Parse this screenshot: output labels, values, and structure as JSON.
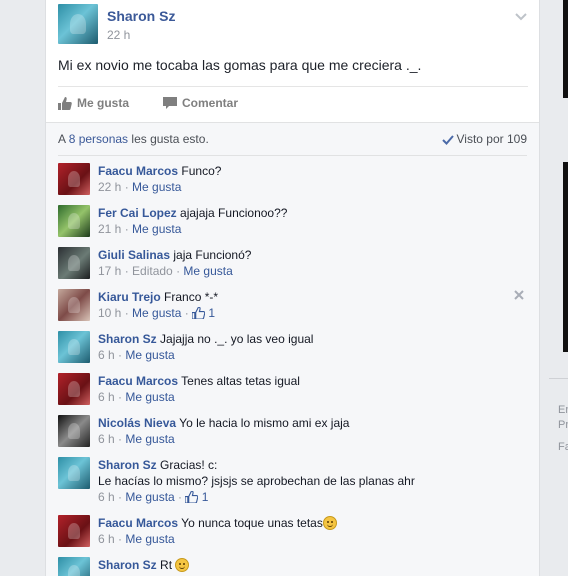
{
  "post": {
    "author": "Sharon Sz",
    "time": "22 h",
    "text": "Mi ex novio me tocaba las gomas para que me creciera ._.",
    "like_label": "Me gusta",
    "comment_label": "Comentar"
  },
  "likes": {
    "prefix": "A ",
    "people": "8 personas",
    "suffix": " les gusta esto.",
    "seen": "Visto por 109"
  },
  "comments": [
    {
      "name": "Faacu Marcos",
      "text": "Funco?",
      "time": "22 h",
      "like": "Me gusta"
    },
    {
      "name": "Fer Cai Lopez",
      "text": "ajajaja Funcionoo??",
      "time": "21 h",
      "like": "Me gusta"
    },
    {
      "name": "Giuli Salinas",
      "text": "jaja Funcionó?",
      "time": "17 h",
      "edited": "Editado",
      "like": "Me gusta"
    },
    {
      "name": "Kiaru Trejo",
      "text": "Franco *-*",
      "time": "10 h",
      "like": "Me gusta",
      "likes": "1"
    },
    {
      "name": "Sharon Sz",
      "text": "Jajajja no ._. yo las veo igual",
      "time": "6 h",
      "like": "Me gusta"
    },
    {
      "name": "Faacu Marcos",
      "text": "Tenes altas tetas igual",
      "time": "6 h",
      "like": "Me gusta"
    },
    {
      "name": "Nicolás Nieva",
      "text": "Yo le hacia lo mismo ami ex jaja",
      "time": "6 h",
      "like": "Me gusta"
    },
    {
      "name": "Sharon Sz",
      "text": "Gracias! c:",
      "text2": "Le hacías lo mismo? jsjsjs se aprobechan de las planas ahr",
      "time": "6 h",
      "like": "Me gusta",
      "likes": "1"
    },
    {
      "name": "Faacu Marcos",
      "text": "Yo nunca toque unas tetas",
      "time": "6 h",
      "like": "Me gusta"
    },
    {
      "name": "Sharon Sz",
      "text": "Rt",
      "time": "",
      "like": ""
    }
  ],
  "sidebar": {
    "fragments": [
      "Er",
      "Pr",
      "Fa"
    ]
  },
  "colors": {
    "link": "#365899",
    "background": "#e9ebee",
    "meta": "#90949c"
  }
}
